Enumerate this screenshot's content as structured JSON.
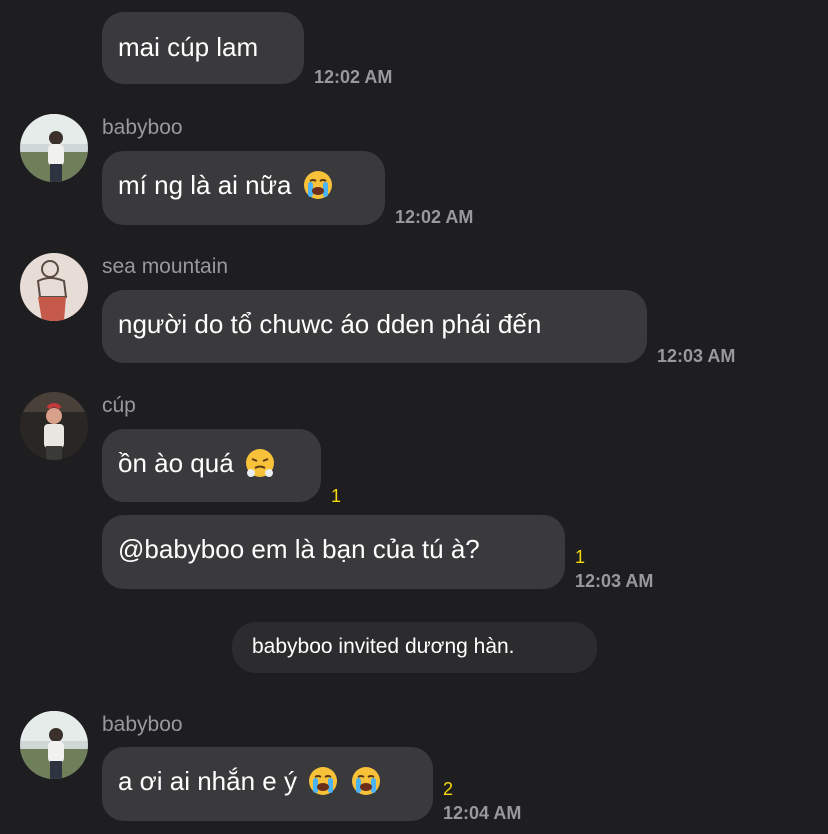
{
  "messages": [
    {
      "sender": "",
      "text": "mai cúp lam",
      "time": "12:02 AM",
      "emojis": []
    },
    {
      "sender": "babyboo",
      "text": "mí ng là ai nữa",
      "time": "12:02 AM",
      "emojis": [
        "loudly-crying-face"
      ]
    },
    {
      "sender": "sea mountain",
      "text": "người do tổ chuwc áo dden phái đến",
      "time": "12:03 AM",
      "emojis": []
    },
    {
      "sender": "cúp",
      "text": "ồn ào quá",
      "time": "",
      "emojis": [
        "face-with-steam"
      ],
      "reaction_count": "1"
    },
    {
      "sender": "",
      "text": "@babyboo em là bạn của tú à?",
      "time": "12:03 AM",
      "emojis": [],
      "reaction_count": "1"
    },
    {
      "sender": "babyboo",
      "text": "a ơi ai nhắn e ý",
      "time": "12:04 AM",
      "emojis": [
        "loudly-crying-face",
        "loudly-crying-face"
      ],
      "reaction_count": "2"
    }
  ],
  "system": {
    "invite_text": "babyboo invited dương hàn."
  },
  "colors": {
    "background": "#1e1e20",
    "bubble": "#3a3a3c",
    "system_pill": "#2c2c2e",
    "secondary_text": "#98989e",
    "reaction_count": "#f5d90a"
  }
}
